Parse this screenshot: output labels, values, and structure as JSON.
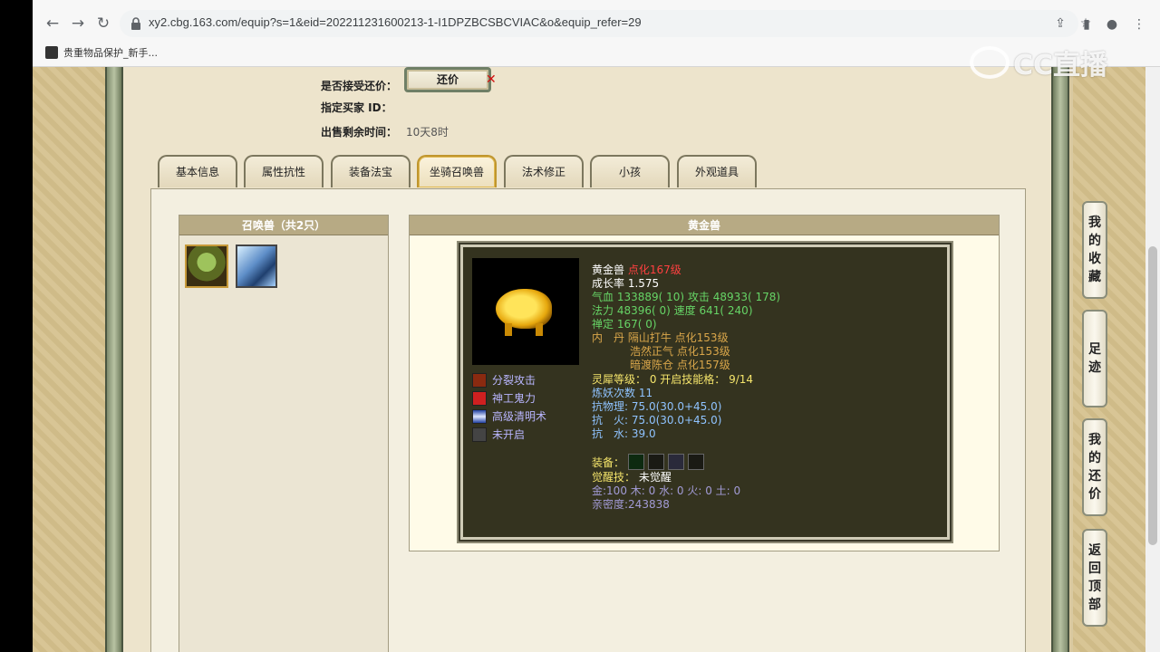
{
  "browser": {
    "url": "xy2.cbg.163.com/equip?s=1&eid=202211231600213-1-I1DPZBCSBCVIAC&o&equip_refer=29",
    "bookmark": "贵重物品保护_新手...",
    "watermark": "CC直播"
  },
  "sale_info": {
    "accept_counter_label": "是否接受还价：",
    "counter_button": "还价",
    "buyer_id_label": "指定买家 ID：",
    "remaining_label": "出售剩余时间：",
    "remaining_value": "10天8时"
  },
  "tabs": [
    "基本信息",
    "属性抗性",
    "装备法宝",
    "坐骑召唤兽",
    "法术修正",
    "小孩",
    "外观道具"
  ],
  "active_tab": "坐骑召唤兽",
  "pets_box": {
    "header": "召唤兽（共2只）"
  },
  "pet_detail": {
    "header": "黄金兽",
    "name": "黄金兽",
    "level": "点化167级",
    "growth": "成长率 1.575",
    "hp_label": "气血",
    "hp": "133889( 10)",
    "atk_label": "攻击",
    "atk": "48933( 178)",
    "mp_label": "法力",
    "mp": "48396( 0)",
    "spd_label": "速度",
    "spd": "641( 240)",
    "zen_label": "禅定",
    "zen": "167( 0)",
    "neidan_label": "内　丹",
    "neidan1": "隔山打牛 点化153级",
    "neidan2": "浩然正气 点化153级",
    "neidan3": "暗渡陈仓 点化157级",
    "spirit": "灵犀等级：  0 开启技能格：  9/14",
    "refine": "炼妖次数 11",
    "res_phys": "抗物理: 75.0(30.0+45.0)",
    "res_fire": "抗　火: 75.0(30.0+45.0)",
    "res_water": "抗　水: 39.0",
    "equip_label": "装备：",
    "awaken_label": "觉醒技：",
    "awaken_value": "未觉醒",
    "elements": "金:100 木: 0 水: 0 火: 0 土: 0",
    "intimacy": "亲密度:243838",
    "skills": [
      "分裂攻击",
      "神工鬼力",
      "高级清明术",
      "未开启"
    ]
  },
  "side_buttons": [
    {
      "label": "我的收藏",
      "chars": [
        "我",
        "的",
        "收",
        "藏"
      ]
    },
    {
      "label": "足迹",
      "chars": [
        "足",
        "迹"
      ]
    },
    {
      "label": "我的还价",
      "chars": [
        "我",
        "的",
        "还",
        "价"
      ]
    },
    {
      "label": "返回顶部",
      "chars": [
        "返",
        "回",
        "顶",
        "部"
      ]
    }
  ]
}
